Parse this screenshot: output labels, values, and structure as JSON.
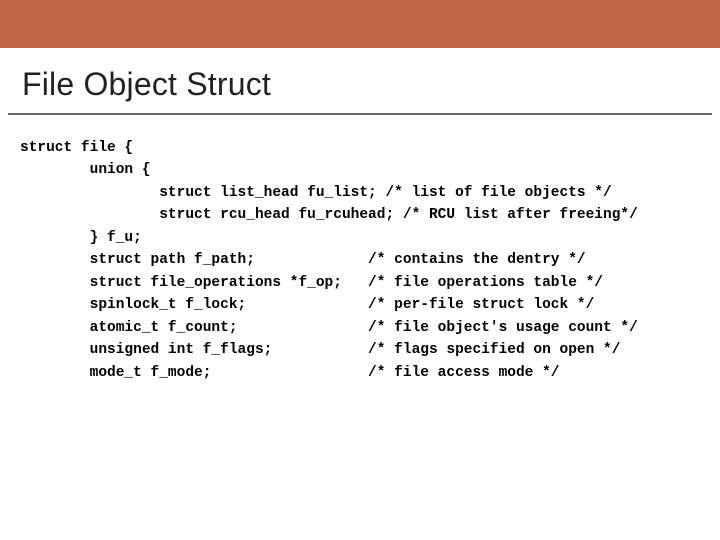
{
  "accent_color": "#c1674c",
  "title": "File Object Struct",
  "code_lines": [
    "struct file {",
    "        union {",
    "                struct list_head fu_list; /* list of file objects */",
    "                struct rcu_head fu_rcuhead; /* RCU list after freeing*/",
    "        } f_u;",
    "        struct path f_path;             /* contains the dentry */",
    "        struct file_operations *f_op;   /* file operations table */",
    "        spinlock_t f_lock;              /* per-file struct lock */",
    "        atomic_t f_count;               /* file object's usage count */",
    "        unsigned int f_flags;           /* flags specified on open */",
    "        mode_t f_mode;                  /* file access mode */"
  ]
}
